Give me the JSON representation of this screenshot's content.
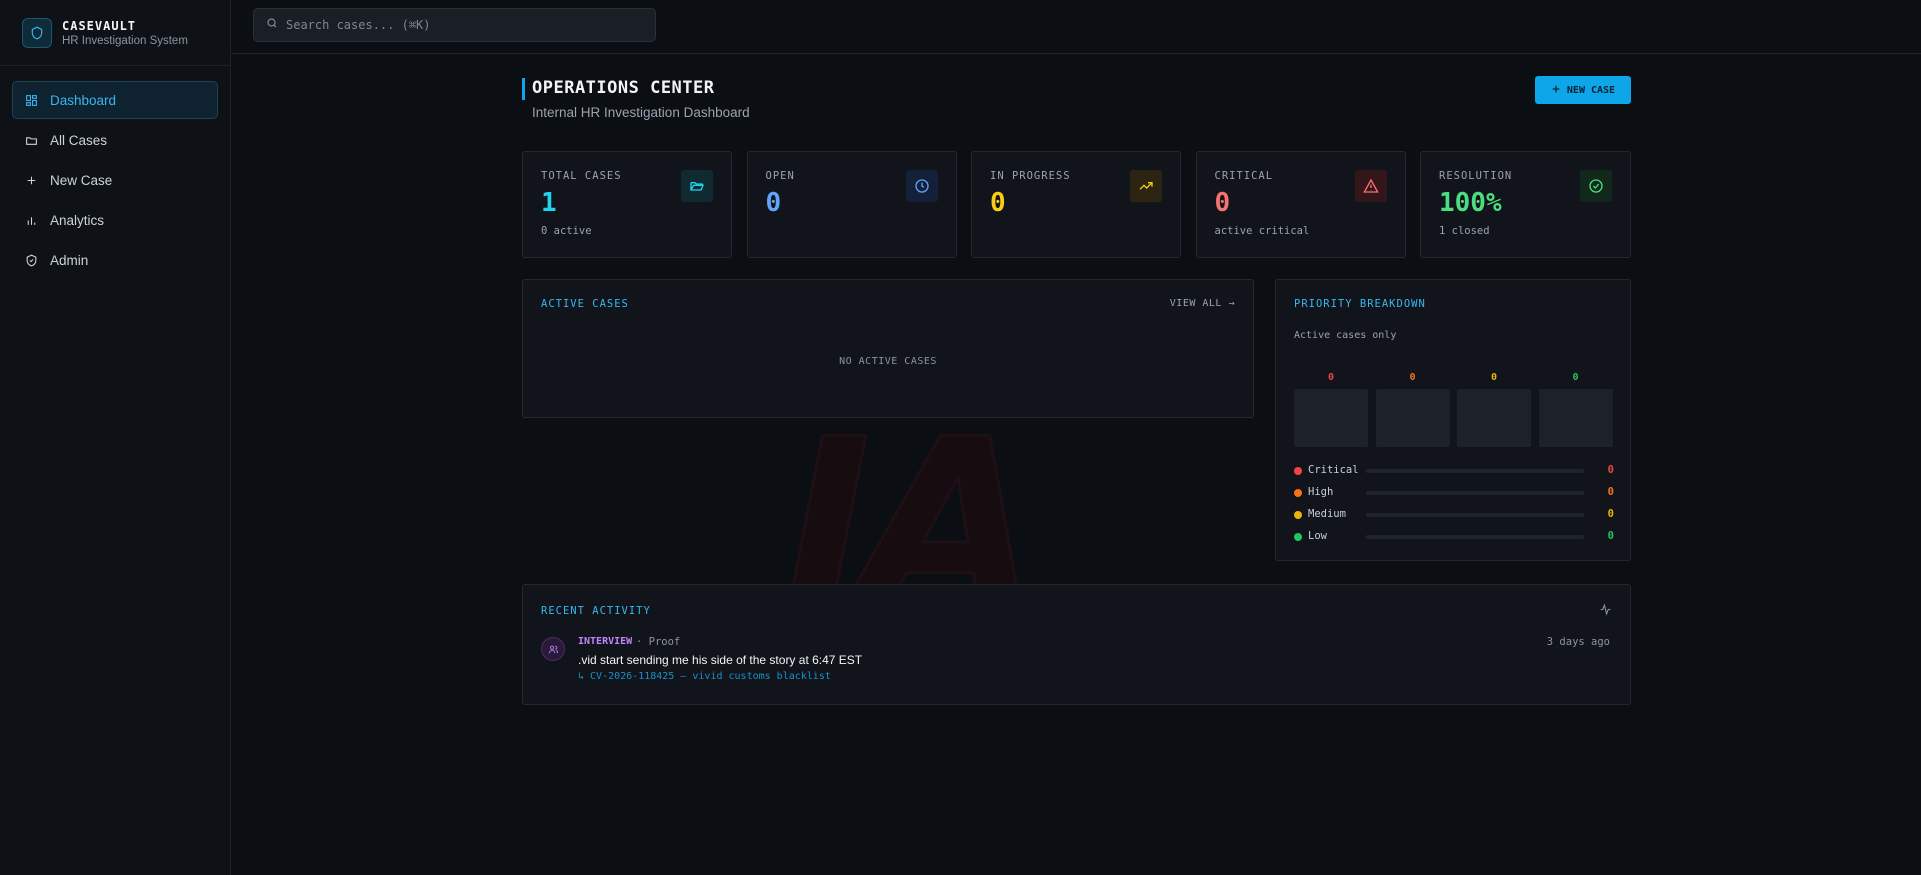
{
  "brand": {
    "title": "CASEVAULT",
    "subtitle": "HR Investigation System"
  },
  "sidebar": {
    "items": [
      {
        "label": "Dashboard",
        "icon": "grid-icon",
        "active": true
      },
      {
        "label": "All Cases",
        "icon": "folder-icon"
      },
      {
        "label": "New Case",
        "icon": "plus-icon"
      },
      {
        "label": "Analytics",
        "icon": "bar-chart-icon"
      },
      {
        "label": "Admin",
        "icon": "shield-check-icon"
      }
    ]
  },
  "search": {
    "placeholder": "Search cases... (⌘K)"
  },
  "header": {
    "title": "OPERATIONS CENTER",
    "subtitle": "Internal HR Investigation Dashboard",
    "new_case_label": "NEW CASE"
  },
  "stats": [
    {
      "label": "TOTAL CASES",
      "value": "1",
      "sub": "0 active",
      "color": "#22d3ee",
      "icon": "folder-open-icon"
    },
    {
      "label": "OPEN",
      "value": "0",
      "sub": "",
      "color": "#60a5fa",
      "icon": "clock-icon"
    },
    {
      "label": "IN PROGRESS",
      "value": "0",
      "sub": "",
      "color": "#facc15",
      "icon": "trending-up-icon"
    },
    {
      "label": "CRITICAL",
      "value": "0",
      "sub": "active critical",
      "color": "#f87171",
      "icon": "alert-triangle-icon"
    },
    {
      "label": "RESOLUTION",
      "value": "100%",
      "sub": "1 closed",
      "color": "#4ade80",
      "icon": "check-circle-icon"
    }
  ],
  "active_cases": {
    "title": "ACTIVE CASES",
    "view_all": "VIEW ALL →",
    "empty": "NO ACTIVE CASES"
  },
  "priority": {
    "title": "PRIORITY BREAKDOWN",
    "subtitle": "Active cases only",
    "levels": [
      {
        "label": "Critical",
        "value": "0",
        "color": "#ef4444"
      },
      {
        "label": "High",
        "value": "0",
        "color": "#f97316"
      },
      {
        "label": "Medium",
        "value": "0",
        "color": "#eab308"
      },
      {
        "label": "Low",
        "value": "0",
        "color": "#22c55e"
      }
    ]
  },
  "activity": {
    "title": "RECENT ACTIVITY",
    "items": [
      {
        "type": "INTERVIEW",
        "meta": "· Proof",
        "text": ".vid start sending me his side of the story at 6:47 EST",
        "link": "↳ CV-2026-118425 — vivid customs blacklist",
        "time": "3 days ago"
      }
    ]
  },
  "watermark": "IA"
}
